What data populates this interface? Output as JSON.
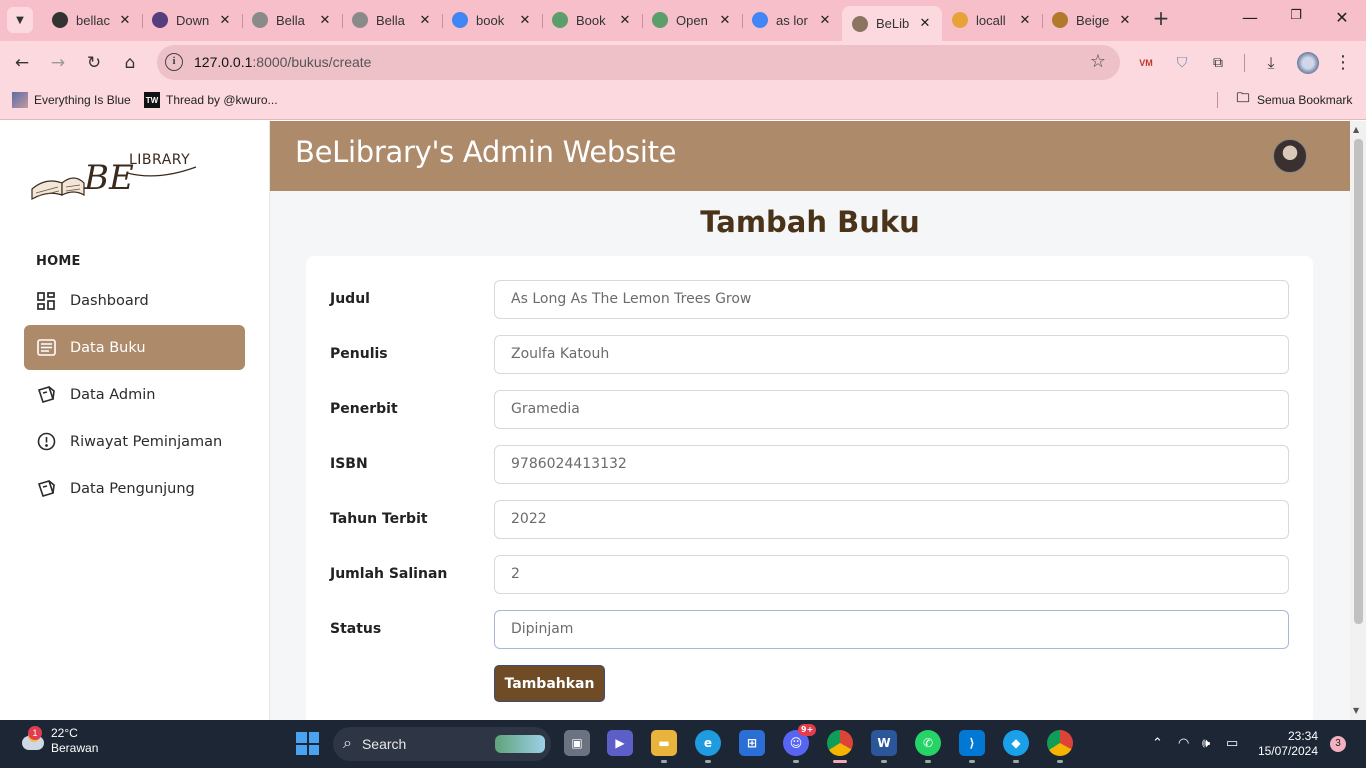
{
  "browser": {
    "tabs": [
      {
        "title": "bellac",
        "favicon": "github-icon",
        "color": "#333333"
      },
      {
        "title": "Down",
        "favicon": "bootstrap-icon",
        "color": "#563d7c"
      },
      {
        "title": "Bella",
        "favicon": "globe-icon",
        "color": "#8a8a8a"
      },
      {
        "title": "Bella",
        "favicon": "globe-icon",
        "color": "#8a8a8a"
      },
      {
        "title": "book",
        "favicon": "google-icon",
        "color": "#4285f4"
      },
      {
        "title": "Book",
        "favicon": "openai-icon",
        "color": "#5a9e6a"
      },
      {
        "title": "Open",
        "favicon": "openai-icon",
        "color": "#5a9e6a"
      },
      {
        "title": "as lor",
        "favicon": "google-icon",
        "color": "#4285f4"
      },
      {
        "title": "BeLib",
        "favicon": "belibrary-icon",
        "color": "#8c7560"
      },
      {
        "title": "locall",
        "favicon": "phpmyadmin-icon",
        "color": "#e8a23a"
      },
      {
        "title": "Beige",
        "favicon": "beige-icon",
        "color": "#b07a2a"
      }
    ],
    "active_tab_index": 8,
    "url_host": "127.0.0.1",
    "url_path": ":8000/bukus/create",
    "bookmarks": [
      {
        "label": "Everything Is Blue"
      },
      {
        "label": "Thread by @kwuro..."
      }
    ],
    "all_bookmarks_label": "Semua Bookmark"
  },
  "sidebar": {
    "section_label": "HOME",
    "logo_text_top": "LIBRARY",
    "logo_text_big": "BE",
    "items": [
      {
        "label": "Dashboard",
        "icon": "dashboard-icon"
      },
      {
        "label": "Data Buku",
        "icon": "book-list-icon"
      },
      {
        "label": "Data Admin",
        "icon": "cards-icon"
      },
      {
        "label": "Riwayat Peminjaman",
        "icon": "alert-circle-icon"
      },
      {
        "label": "Data Pengunjung",
        "icon": "cards-icon"
      }
    ],
    "active_index": 1
  },
  "header": {
    "title": "BeLibrary's Admin Website"
  },
  "form": {
    "page_title": "Tambah Buku",
    "fields": [
      {
        "label": "Judul",
        "value": "As Long As The Lemon Trees Grow"
      },
      {
        "label": "Penulis",
        "value": "Zoulfa Katouh"
      },
      {
        "label": "Penerbit",
        "value": "Gramedia"
      },
      {
        "label": "ISBN",
        "value": "9786024413132"
      },
      {
        "label": "Tahun Terbit",
        "value": "2022"
      },
      {
        "label": "Jumlah Salinan",
        "value": "2"
      },
      {
        "label": "Status",
        "value": "Dipinjam"
      }
    ],
    "submit_label": "Tambahkan"
  },
  "taskbar": {
    "weather_temp": "22°C",
    "weather_desc": "Berawan",
    "weather_badge": "1",
    "search_label": "Search",
    "discord_badge": "9+",
    "time": "23:34",
    "date": "15/07/2024",
    "notifications": "3"
  },
  "colors": {
    "chrome_pink": "#f6bfc9",
    "accent_brown": "#ac8a6a",
    "title_brown": "#4b3319",
    "button_brown": "#6f4c26"
  }
}
